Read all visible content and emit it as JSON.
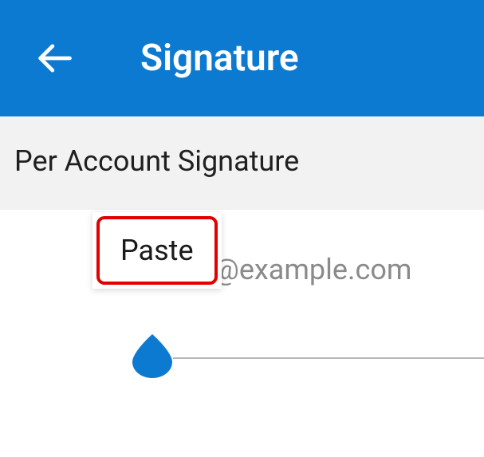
{
  "header": {
    "title": "Signature"
  },
  "section": {
    "title": "Per Account Signature"
  },
  "content": {
    "email_partial": "il@example.com"
  },
  "popup": {
    "paste_label": "Paste"
  },
  "colors": {
    "primary": "#0d7ad1",
    "highlight": "#e30000",
    "muted_text": "#8a8a8a"
  }
}
